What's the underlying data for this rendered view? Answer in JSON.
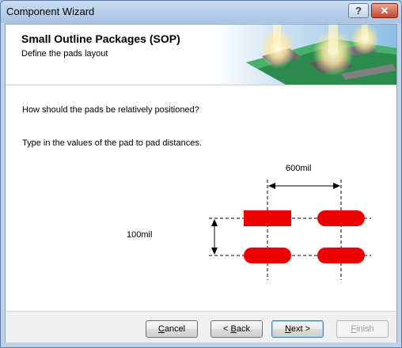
{
  "window": {
    "title": "Component Wizard",
    "help_glyph": "?",
    "close_glyph": "✕"
  },
  "header": {
    "title": "Small Outline Packages (SOP)",
    "subtitle": "Define the pads layout"
  },
  "body": {
    "question": "How should the pads be relatively positioned?",
    "instruction": "Type in the values of the pad to pad distances.",
    "horizontal_distance": "600mil",
    "vertical_distance": "100mil"
  },
  "buttons": {
    "cancel": {
      "label": "Cancel",
      "mnemonic": "C"
    },
    "back": {
      "label": "< Back",
      "mnemonic": "B"
    },
    "next": {
      "label": "Next >",
      "mnemonic": "N"
    },
    "finish": {
      "label": "Finish",
      "mnemonic": "F"
    }
  },
  "colors": {
    "pad": "#ee0000",
    "accent": "#3c7fb1"
  }
}
